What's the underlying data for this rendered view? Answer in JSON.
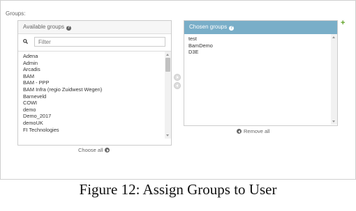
{
  "groups_label": "Groups:",
  "available": {
    "title": "Available groups",
    "filter_placeholder": "Filter",
    "items": [
      "Adena",
      "Admin",
      "Arcadis",
      "BAM",
      "BAM - PPP",
      "BAM Infra (regio Zuidwest Wegen)",
      "Barneveld",
      "COWI",
      "demo",
      "Demo_2017",
      "demoUK",
      "FI Technologies"
    ],
    "choose_all": "Choose all"
  },
  "chosen": {
    "title": "Chosen groups",
    "items": [
      "test",
      "BamDemo",
      "D3E"
    ],
    "remove_all": "Remove all"
  },
  "caption": "Figure 12: Assign Groups to User",
  "colors": {
    "chosen_header": "#79aec8",
    "add_icon": "#5fa225"
  },
  "icons": {
    "help": "help-icon",
    "search": "search-icon",
    "add": "plus-icon",
    "choose": "arrow-right-circle-icon",
    "remove": "arrow-left-circle-icon"
  }
}
